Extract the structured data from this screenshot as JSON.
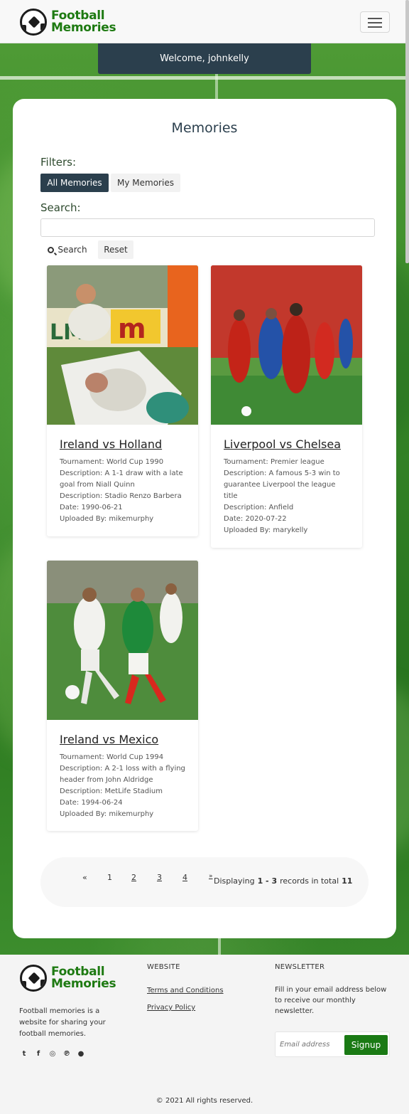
{
  "brand": {
    "line1": "Football",
    "line2": "Memories"
  },
  "welcome": "Welcome, johnkelly",
  "page": {
    "title": "Memories",
    "filters_label": "Filters:",
    "filter_all": "All Memories",
    "filter_mine": "My Memories",
    "search_label": "Search:",
    "search_value": "",
    "search_button": "Search",
    "reset_button": "Reset"
  },
  "memories": [
    {
      "title": "Ireland vs Holland",
      "tournament": "Tournament: World Cup 1990",
      "description": "Description: A 1-1 draw with a late goal from Niall Quinn",
      "venue": "Description: Stadio Renzo Barbera",
      "date": "Date: 1990-06-21",
      "uploaded": "Uploaded By: mikemurphy"
    },
    {
      "title": "Liverpool vs Chelsea",
      "tournament": "Tournament: Premier league",
      "description": "Description: A famous 5-3 win to guarantee Liverpool the league title",
      "venue": "Description: Anfield",
      "date": "Date: 2020-07-22",
      "uploaded": "Uploaded By: marykelly"
    },
    {
      "title": "Ireland vs Mexico",
      "tournament": "Tournament: World Cup 1994",
      "description": "Description: A 2-1 loss with a flying header from John Aldridge",
      "venue": "Description: MetLife Stadium",
      "date": "Date: 1994-06-24",
      "uploaded": "Uploaded By: mikemurphy"
    }
  ],
  "pagination": {
    "prev": "«",
    "pages": [
      "1",
      "2",
      "3",
      "4"
    ],
    "next": "»",
    "display_prefix": "Displaying",
    "range": "1 - 3",
    "middle": "records in total",
    "total": "11"
  },
  "footer": {
    "about": "Football memories is a website for sharing your football memories.",
    "website_heading": "WEBSITE",
    "terms": "Terms and Conditions",
    "privacy": "Privacy Policy",
    "newsletter_heading": "NEWSLETTER",
    "newsletter_text": "Fill in your email address below to receive our monthly newsletter.",
    "email_placeholder": "Email address",
    "signup": "Signup",
    "copyright": "© 2021 All rights reserved.",
    "social_icons": [
      "twitter-icon",
      "facebook-icon",
      "instagram-icon",
      "pinterest-icon",
      "snapchat-icon"
    ]
  }
}
